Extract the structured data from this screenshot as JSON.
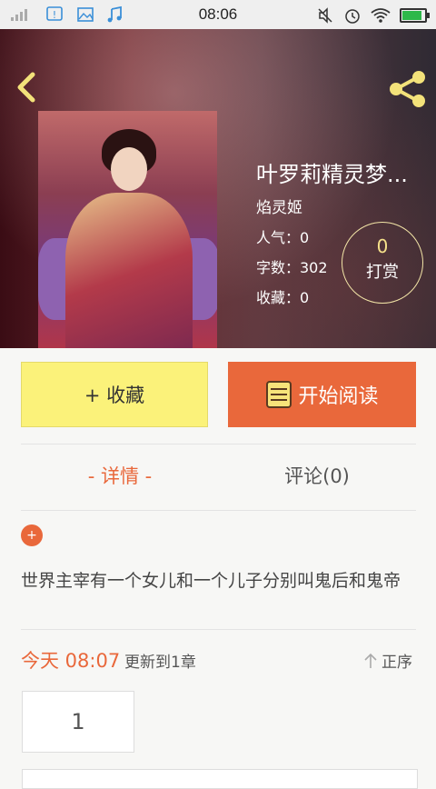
{
  "status_bar": {
    "time": "08:06",
    "icons": [
      "signal-icon",
      "alert-icon",
      "image-icon",
      "music-icon",
      "mute-icon",
      "alarm-icon",
      "wifi-icon",
      "battery-icon"
    ],
    "battery_level": 0.95
  },
  "book": {
    "title": "叶罗莉精灵梦...",
    "author": "焰灵姬",
    "popularity": "人气：0",
    "word_count": "字数：302",
    "favorites": "收藏：0",
    "reward_count": "0",
    "reward_label": "打赏"
  },
  "actions": {
    "favorite_label": "+ 收藏",
    "read_label": "开始阅读"
  },
  "tabs": {
    "detail": "- 详情 -",
    "comments": "评论(0)"
  },
  "detail": {
    "expand_symbol": "+",
    "description": "世界主宰有一个女儿和一个儿子分别叫鬼后和鬼帝"
  },
  "update": {
    "time": "今天 08:07",
    "text": "更新到1章",
    "order_label": "正序"
  },
  "chapters": {
    "page": "1"
  },
  "colors": {
    "accent": "#e9683b",
    "favorite_bg": "#fbf27a",
    "reward_ring": "#f3e5a7"
  }
}
